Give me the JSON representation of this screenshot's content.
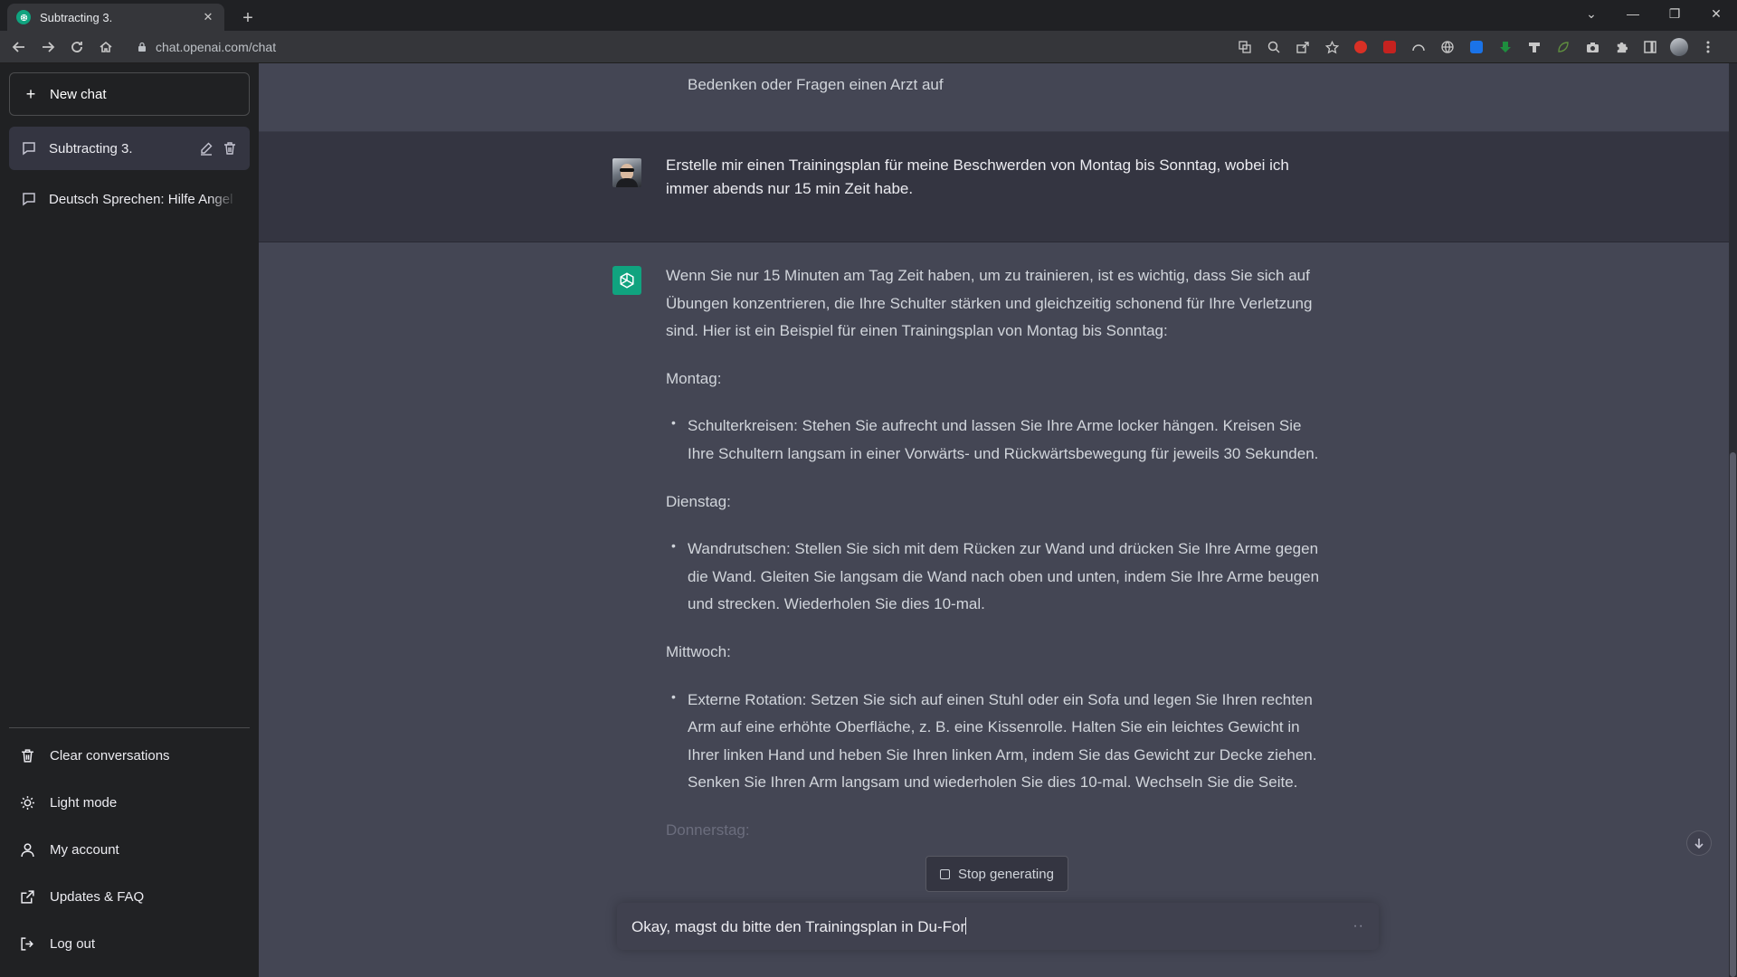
{
  "browser": {
    "tab_title": "Subtracting 3.",
    "tab_close": "✕",
    "new_tab": "+",
    "url": "chat.openai.com/chat",
    "window_controls": [
      "⌄",
      "—",
      "❐",
      "✕"
    ]
  },
  "sidebar": {
    "new_chat_label": "New chat",
    "conversations": [
      {
        "label": "Subtracting 3.",
        "active": true
      },
      {
        "label": "Deutsch Sprechen: Hilfe Angel"
      }
    ],
    "bottom_items": [
      {
        "label": "Clear conversations",
        "icon": "trash-icon"
      },
      {
        "label": "Light mode",
        "icon": "sun-icon"
      },
      {
        "label": "My account",
        "icon": "user-icon"
      },
      {
        "label": "Updates & FAQ",
        "icon": "external-link-icon"
      },
      {
        "label": "Log out",
        "icon": "logout-icon"
      }
    ]
  },
  "conversation": {
    "previous_tail": "Bedenken oder Fragen einen Arzt auf",
    "user_message": "Erstelle mir einen Trainingsplan für meine Beschwerden von Montag bis Sonntag, wobei ich immer abends nur 15 min Zeit habe.",
    "assistant": {
      "intro": "Wenn Sie nur 15 Minuten am Tag Zeit haben, um zu trainieren, ist es wichtig, dass Sie sich auf Übungen konzentrieren, die Ihre Schulter stärken und gleichzeitig schonend für Ihre Verletzung sind. Hier ist ein Beispiel für einen Trainingsplan von Montag bis Sonntag:",
      "days": [
        {
          "day": "Montag:",
          "item": "Schulterkreisen: Stehen Sie aufrecht und lassen Sie Ihre Arme locker hängen. Kreisen Sie Ihre Schultern langsam in einer Vorwärts- und Rückwärtsbewegung für jeweils 30 Sekunden."
        },
        {
          "day": "Dienstag:",
          "item": "Wandrutschen: Stellen Sie sich mit dem Rücken zur Wand und drücken Sie Ihre Arme gegen die Wand. Gleiten Sie langsam die Wand nach oben und unten, indem Sie Ihre Arme beugen und strecken. Wiederholen Sie dies 10-mal."
        },
        {
          "day": "Mittwoch:",
          "item": "Externe Rotation: Setzen Sie sich auf einen Stuhl oder ein Sofa und legen Sie Ihren rechten Arm auf eine erhöhte Oberfläche, z. B. eine Kissenrolle. Halten Sie ein leichtes Gewicht in Ihrer linken Hand und heben Sie Ihren linken Arm, indem Sie das Gewicht zur Decke ziehen. Senken Sie Ihren Arm langsam und wiederholen Sie dies 10-mal. Wechseln Sie die Seite."
        }
      ],
      "trailing_day": "Donnerstag:"
    }
  },
  "composer": {
    "stop_label": "Stop generating",
    "input_value": "Okay, magst du bitte den Trainingsplan in Du-For",
    "typing_indicator": "··"
  }
}
